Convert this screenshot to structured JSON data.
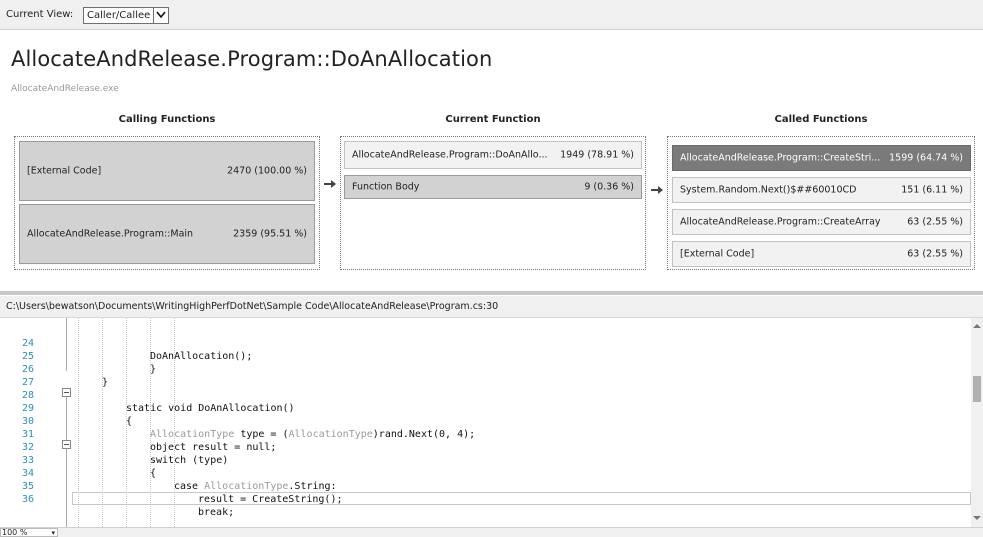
{
  "toolbar": {
    "current_view_label": "Current View:",
    "current_view_value": "Caller/Callee"
  },
  "header": {
    "title": "AllocateAndRelease.Program::DoAnAllocation",
    "subtitle": "AllocateAndRelease.exe"
  },
  "calling": {
    "heading": "Calling Functions",
    "items": [
      {
        "name": "[External Code]",
        "value": "2470 (100.00 %)"
      },
      {
        "name": "AllocateAndRelease.Program::Main",
        "value": "2359 (95.51 %)"
      }
    ]
  },
  "current": {
    "heading": "Current Function",
    "header_row": {
      "name": "AllocateAndRelease.Program::DoAnAllo...",
      "value": "1949 (78.91 %)"
    },
    "body_row": {
      "name": "Function Body",
      "value": "9 (0.36 %)"
    }
  },
  "called": {
    "heading": "Called Functions",
    "items": [
      {
        "name": "AllocateAndRelease.Program::CreateStri...",
        "value": "1599 (64.74 %)"
      },
      {
        "name": "System.Random.Next()$##60010CD",
        "value": "151 (6.11 %)"
      },
      {
        "name": "AllocateAndRelease.Program::CreateArray",
        "value": "63 (2.55 %)"
      },
      {
        "name": "[External Code]",
        "value": "63 (2.55 %)"
      }
    ]
  },
  "source_path": "C:\\Users\\bewatson\\Documents\\WritingHighPerfDotNet\\Sample Code\\AllocateAndRelease\\Program.cs:30",
  "code": {
    "line_numbers": [
      "24",
      "25",
      "26",
      "27",
      "28",
      "29",
      "30",
      "31",
      "32",
      "33",
      "34",
      "35",
      "36"
    ],
    "l24": "DoAnAllocation();",
    "l25": "}",
    "l26": "}",
    "l28": "static void DoAnAllocation()",
    "l29": "{",
    "l30_type": "AllocationType",
    "l30_mid": " type = (",
    "l30_cast": "AllocationType",
    "l30_end": ")rand.Next(0, 4);",
    "l31": "object result = null;",
    "l32": "switch (type)",
    "l33": "{",
    "l34_kw": "case ",
    "l34_type": "AllocationType",
    "l34_end": ".String:",
    "l35": "result = CreateString();",
    "l36": "break;"
  },
  "statusbar": {
    "zoom": "100 %"
  }
}
